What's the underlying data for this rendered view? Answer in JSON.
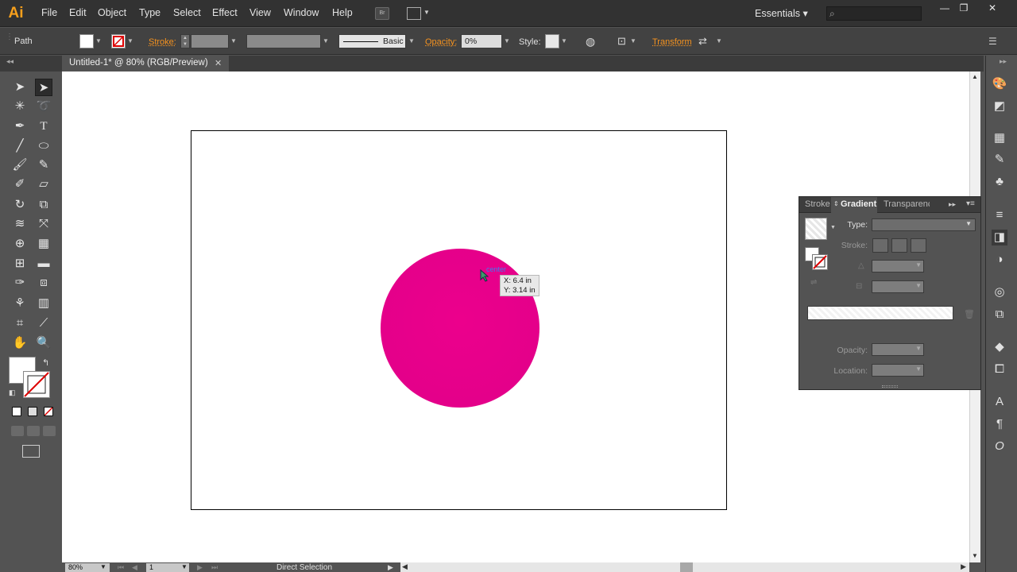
{
  "app": {
    "logo": "Ai",
    "workspace": "Essentials ▾"
  },
  "menu": [
    "File",
    "Edit",
    "Object",
    "Type",
    "Select",
    "Effect",
    "View",
    "Window",
    "Help"
  ],
  "menu_extra": {
    "bridge": "Br"
  },
  "window_controls": {
    "minimize": "—",
    "restore": "❐",
    "close": "✕"
  },
  "control_bar": {
    "selection_label": "Path",
    "stroke_label": "Stroke:",
    "stroke_profile": "Basic",
    "opacity_label": "Opacity:",
    "opacity_value": "0%",
    "style_label": "Style:",
    "transform_label": "Transform"
  },
  "document": {
    "tab_title": "Untitled-1* @ 80% (RGB/Preview)",
    "close": "✕"
  },
  "canvas": {
    "shape_color": "#e6008a",
    "smart_guide_label": "center",
    "cursor_x": "X: 6.4 in",
    "cursor_y": "Y: 3.14 in"
  },
  "gradient_panel": {
    "tabs": [
      "Stroke",
      "Gradient",
      "Transparency"
    ],
    "active_tab": "Gradient",
    "type_label": "Type:",
    "stroke_label": "Stroke:",
    "opacity_label": "Opacity:",
    "location_label": "Location:"
  },
  "status_bar": {
    "zoom": "80%",
    "page": "1",
    "tool": "Direct Selection"
  },
  "icons": {
    "tools": [
      "selection-arrow-icon",
      "direct-selection-icon",
      "magic-wand-icon",
      "lasso-icon",
      "pen-icon",
      "type-icon",
      "line-icon",
      "ellipse-icon",
      "paintbrush-icon",
      "pencil-icon",
      "blob-brush-icon",
      "eraser-icon",
      "rotate-icon",
      "scale-icon",
      "warp-icon",
      "free-transform-icon",
      "shape-builder-icon",
      "perspective-grid-icon",
      "mesh-icon",
      "gradient-icon",
      "eyedropper-icon",
      "blend-icon",
      "symbol-sprayer-icon",
      "column-graph-icon",
      "artboard-icon",
      "slice-icon",
      "hand-icon",
      "zoom-icon"
    ]
  }
}
